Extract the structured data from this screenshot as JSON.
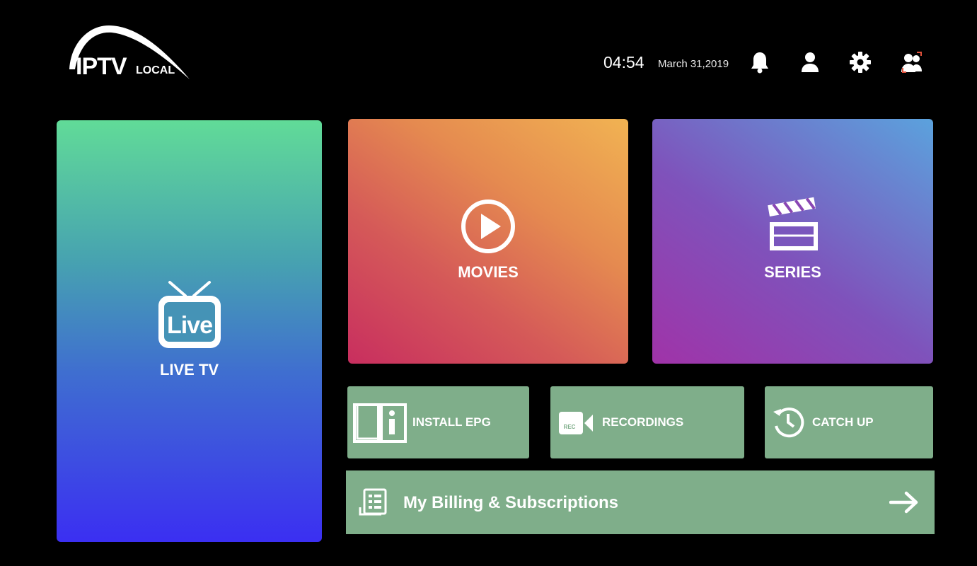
{
  "header": {
    "logo": {
      "name": "IPTV",
      "suffix": "LOCAL"
    },
    "time": "04:54",
    "date": "March 31,2019",
    "icons": [
      "bell-icon",
      "user-icon",
      "gear-icon",
      "switch-user-icon"
    ]
  },
  "tiles": {
    "live_tv": {
      "label": "LIVE TV",
      "badge": "Live",
      "icon": "live-tv-icon"
    },
    "movies": {
      "label": "MOVIES",
      "icon": "play-circle-icon"
    },
    "series": {
      "label": "SERIES",
      "icon": "clapperboard-icon"
    }
  },
  "shortcuts": {
    "install_epg": {
      "label": "INSTALL EPG",
      "icon": "book-info-icon"
    },
    "recordings": {
      "label": "RECORDINGS",
      "icon": "rec-camera-icon",
      "badge": "REC"
    },
    "catch_up": {
      "label": "CATCH UP",
      "icon": "history-icon"
    }
  },
  "billing": {
    "label": "My Billing & Subscriptions",
    "icon": "receipt-icon",
    "arrow_icon": "arrow-right-icon"
  },
  "colors": {
    "background": "#000000",
    "shortcut_bg": "#7fae8a",
    "live_gradient": [
      "#61db98",
      "#3b2ff2"
    ],
    "movies_gradient": [
      "#c82e5f",
      "#f1b352"
    ],
    "series_gradient": [
      "#a033a8",
      "#5ba2dd"
    ]
  }
}
